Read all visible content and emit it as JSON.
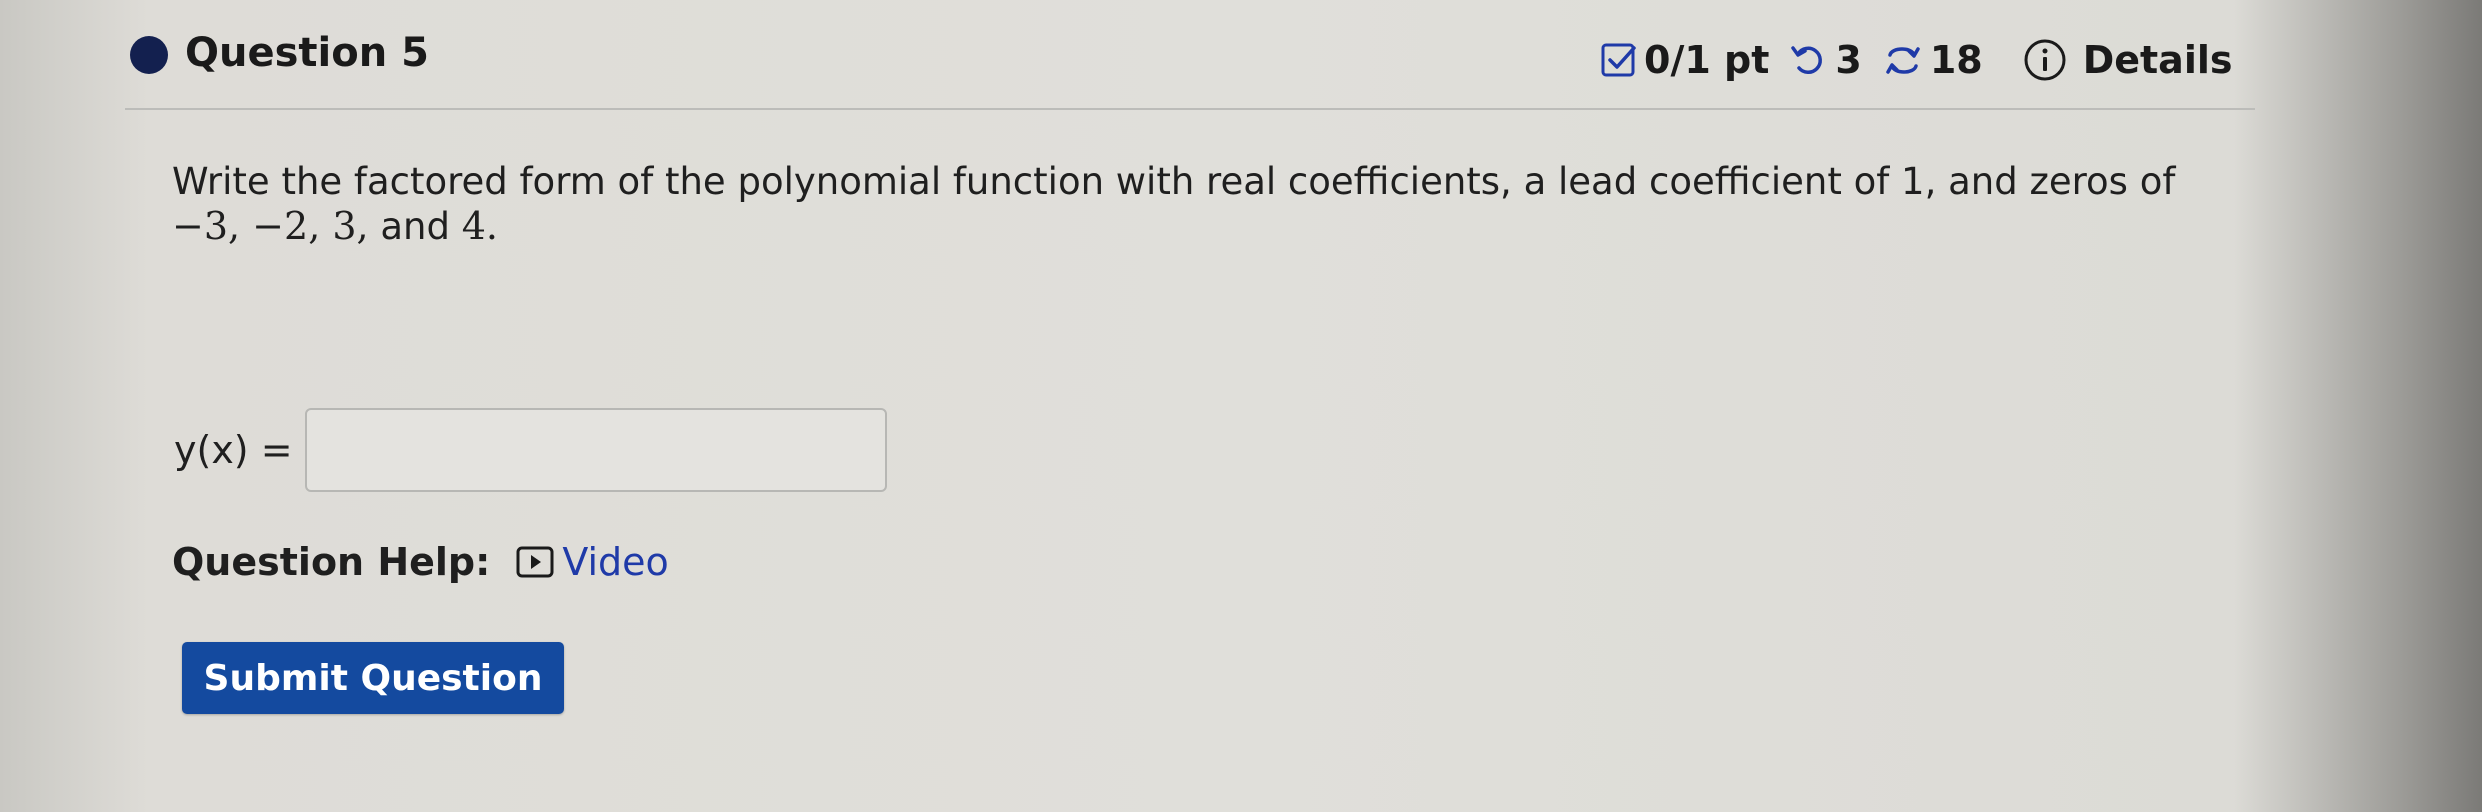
{
  "header": {
    "question_title": "Question 5",
    "score": "0/1 pt",
    "retries": "3",
    "attempts": "18",
    "details_label": "Details"
  },
  "question": {
    "text_prefix": "Write the factored form of the polynomial function with real coefficients, a lead coefficient of 1, and zeros of ",
    "zeros": "−3, −2, 3,",
    "and_word": " and ",
    "last_zero": "4."
  },
  "answer": {
    "label": "y(x) =",
    "value": "",
    "placeholder": ""
  },
  "help": {
    "label": "Question Help:",
    "video_label": "Video"
  },
  "actions": {
    "submit_label": "Submit Question"
  },
  "colors": {
    "accent": "#144a9f",
    "link": "#1f3aa8",
    "dot": "#13204f"
  }
}
